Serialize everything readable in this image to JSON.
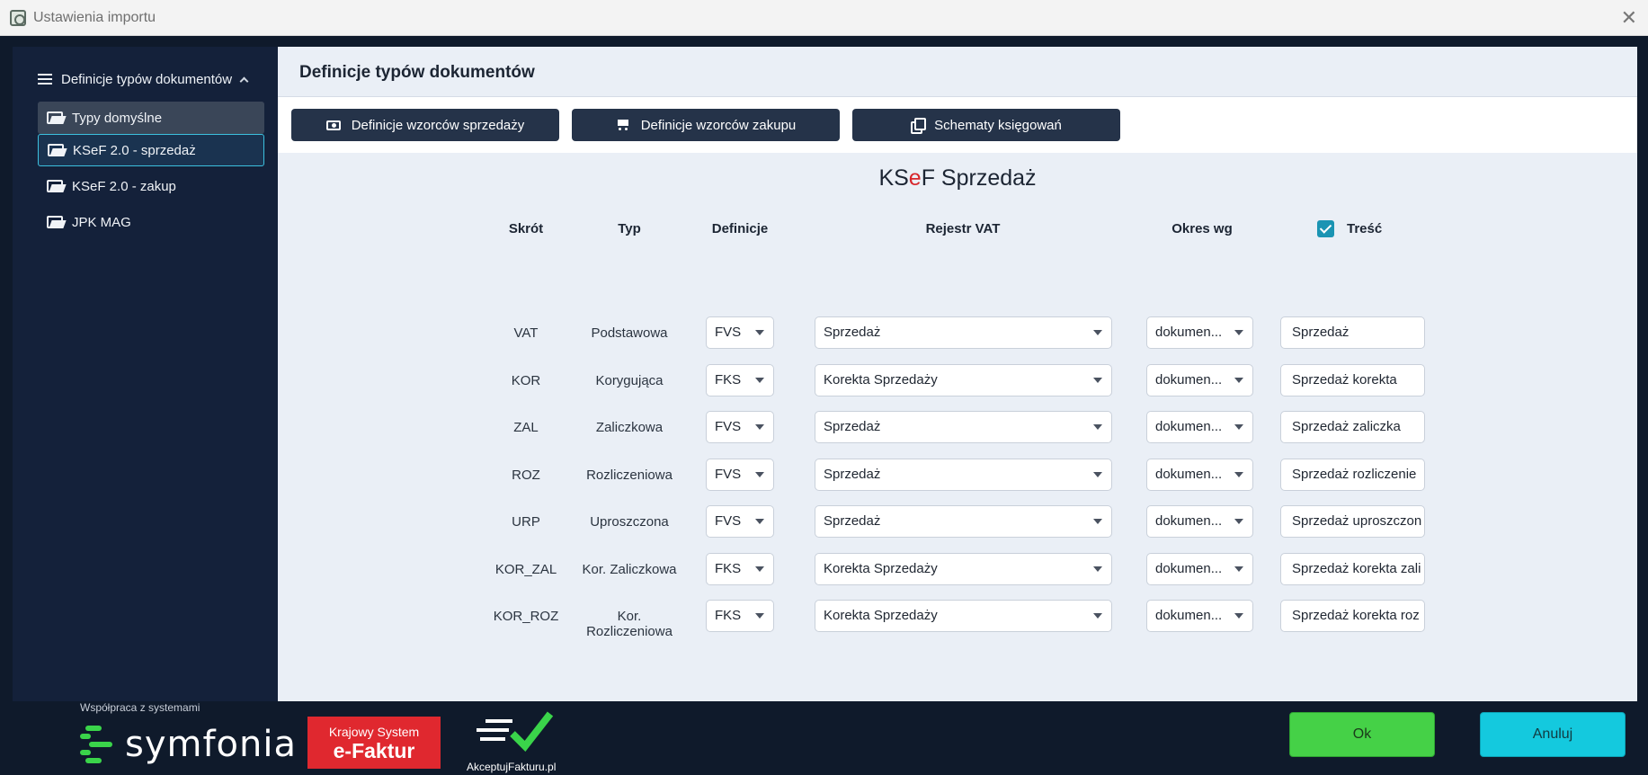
{
  "window": {
    "title": "Ustawienia importu"
  },
  "sidebar": {
    "header": "Definicje typów dokumentów",
    "items": [
      {
        "label": "Typy domyślne"
      },
      {
        "label": "KSeF 2.0 - sprzedaż"
      },
      {
        "label": "KSeF 2.0 - zakup"
      },
      {
        "label": "JPK MAG"
      }
    ]
  },
  "main": {
    "title": "Definicje typów dokumentów",
    "toolbar": [
      {
        "label": "Definicje wzorców sprzedaży",
        "icon": "money-icon"
      },
      {
        "label": "Definicje wzorców zakupu",
        "icon": "cart-icon"
      },
      {
        "label": "Schematy księgowań",
        "icon": "copy-icon"
      }
    ],
    "section_title": {
      "part1": "KS",
      "part2": "e",
      "part3": "F Sprzedaż"
    },
    "columns": {
      "skrot": "Skrót",
      "typ": "Typ",
      "definicje": "Definicje",
      "rejestr": "Rejestr VAT",
      "okres": "Okres wg",
      "tresc": "Treść"
    },
    "tresc_checked": true,
    "rows": [
      {
        "skrot": "VAT",
        "typ": "Podstawowa",
        "def": "FVS",
        "rejestr": "Sprzedaż",
        "okres": "dokumen...",
        "tresc": "Sprzedaż"
      },
      {
        "skrot": "KOR",
        "typ": "Korygująca",
        "def": "FKS",
        "rejestr": "Korekta Sprzedaży",
        "okres": "dokumen...",
        "tresc": "Sprzedaż korekta"
      },
      {
        "skrot": "ZAL",
        "typ": "Zaliczkowa",
        "def": "FVS",
        "rejestr": "Sprzedaż",
        "okres": "dokumen...",
        "tresc": "Sprzedaż zaliczka"
      },
      {
        "skrot": "ROZ",
        "typ": "Rozliczeniowa",
        "def": "FVS",
        "rejestr": "Sprzedaż",
        "okres": "dokumen...",
        "tresc": "Sprzedaż rozliczenie"
      },
      {
        "skrot": "URP",
        "typ": "Uproszczona",
        "def": "FVS",
        "rejestr": "Sprzedaż",
        "okres": "dokumen...",
        "tresc": "Sprzedaż uproszczon"
      },
      {
        "skrot": "KOR_ZAL",
        "typ": "Kor. Zaliczkowa",
        "def": "FKS",
        "rejestr": "Korekta Sprzedaży",
        "okres": "dokumen...",
        "tresc": "Sprzedaż korekta zali"
      },
      {
        "skrot": "KOR_ROZ",
        "typ": "Kor. Rozliczeniowa",
        "def": "FKS",
        "rejestr": "Korekta Sprzedaży",
        "okres": "dokumen...",
        "tresc": "Sprzedaż korekta roz"
      }
    ]
  },
  "footer": {
    "cooperation_label": "Współpraca z systemami",
    "symfonia": "symfonia",
    "ksef_line1": "Krajowy System",
    "ksef_line2": "e-Faktur",
    "akceptuj": "AkceptujFakturu.pl",
    "ok": "Ok",
    "cancel": "Anuluj"
  },
  "colors": {
    "accent": "#1b94b3",
    "ok": "#45d147",
    "cancel": "#14c9de",
    "brand_red": "#d7262b",
    "sidebar": "#14213a",
    "toolbar_button": "#253349"
  }
}
